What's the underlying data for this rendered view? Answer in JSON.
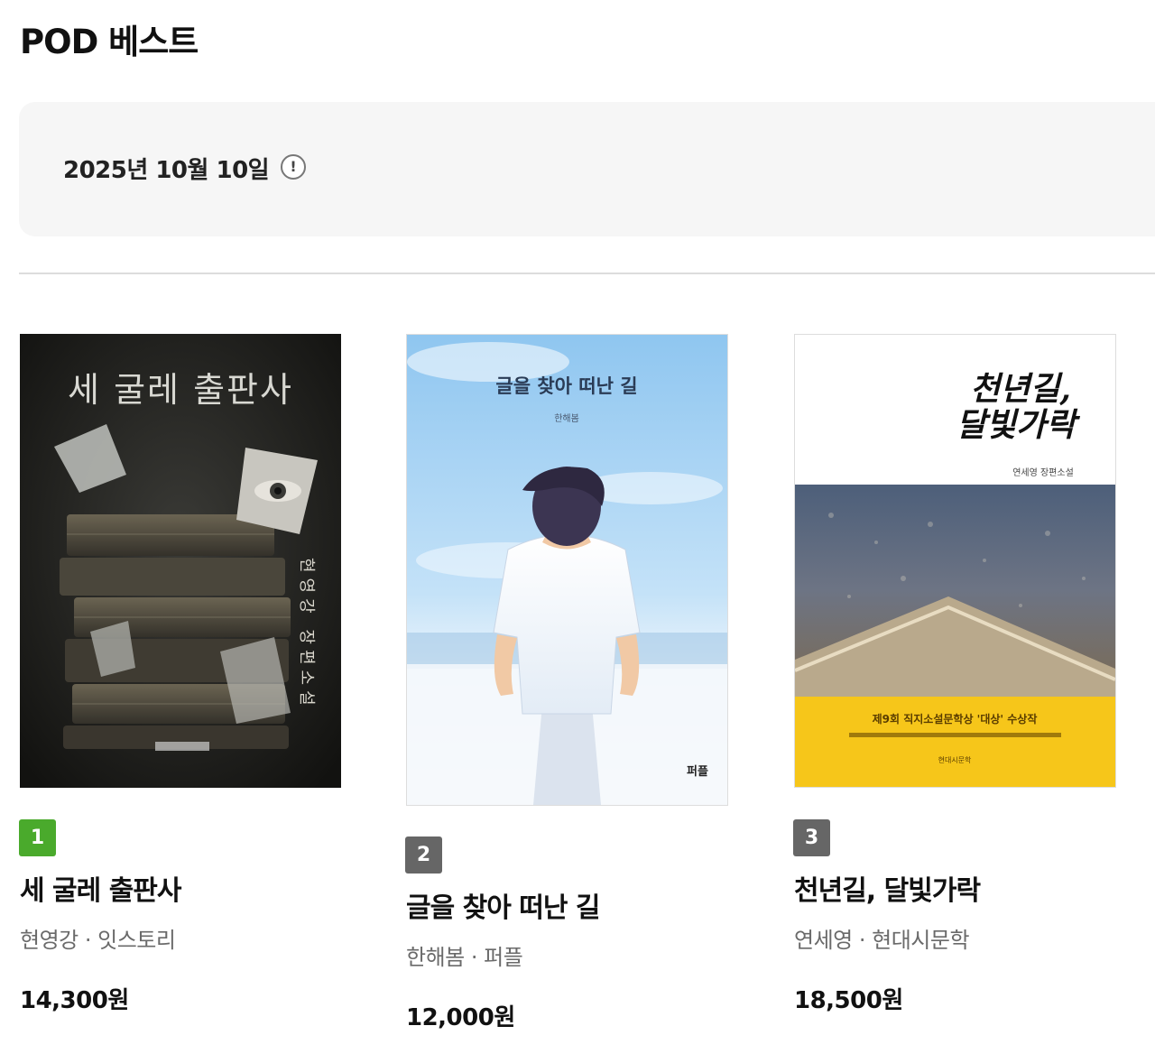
{
  "section": {
    "title": "POD 베스트"
  },
  "date_bar": {
    "date": "2025년 10월 10일",
    "info_symbol": "!"
  },
  "colors": {
    "rank_first": "#4aaa2c",
    "rank_other": "#666666"
  },
  "books": [
    {
      "rank": "1",
      "title": "세 굴레 출판사",
      "author": "현영강",
      "publisher": "잇스토리",
      "separator": " · ",
      "price": "14,300원",
      "cover_title": "세 굴레 출판사",
      "cover_side_text": "현영강 장편소설"
    },
    {
      "rank": "2",
      "title": "글을 찾아 떠난 길",
      "author": "한해봄",
      "publisher": "퍼플",
      "separator": " · ",
      "price": "12,000원",
      "cover_title": "글을 찾아 떠난 길",
      "cover_author": "한해봄"
    },
    {
      "rank": "3",
      "title": "천년길, 달빛가락",
      "author": "연세영",
      "publisher": "현대시문학",
      "separator": " · ",
      "price": "18,500원",
      "cover_title_line1": "천년길,",
      "cover_title_line2": "달빛가락",
      "cover_subtitle": "연세영 장편소설",
      "cover_band_line1": "제9회 직지소설문학상 '대상' 수상작",
      "cover_band_line3": "현대시문학"
    }
  ]
}
